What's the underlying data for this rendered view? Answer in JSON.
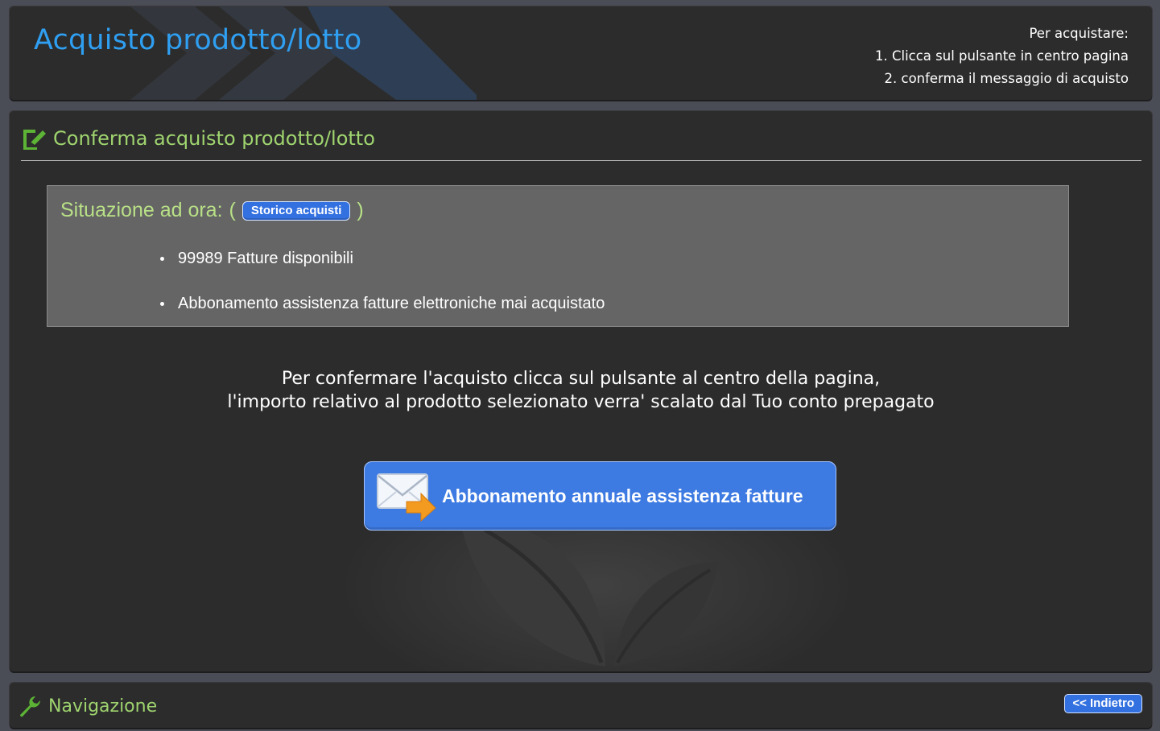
{
  "header": {
    "title": "Acquisto prodotto/lotto",
    "instructions": {
      "intro": "Per acquistare:",
      "step1": "1. Clicca sul pulsante in centro pagina",
      "step2": "2. conferma il messaggio di acquisto"
    }
  },
  "section": {
    "title": "Conferma acquisto prodotto/lotto",
    "icon": "edit-document-icon"
  },
  "status": {
    "label": "Situazione ad ora:",
    "open_paren": "(",
    "close_paren": ")",
    "history_button": "Storico acquisti",
    "items": [
      "99989 Fatture disponibili",
      "Abbonamento assistenza fatture elettroniche mai acquistato"
    ]
  },
  "confirm": {
    "line1": "Per confermare l'acquisto clicca sul pulsante al centro della pagina,",
    "line2": "l'importo relativo al prodotto selezionato verra' scalato dal Tuo conto prepagato"
  },
  "purchase_button": {
    "label": "Abbonamento annuale assistenza fatture",
    "icon": "mail-send-icon"
  },
  "footer": {
    "nav_label": "Navigazione",
    "nav_icon": "wrench-icon",
    "back_button": "<< Indietro"
  },
  "colors": {
    "title_blue": "#2f9ff2",
    "section_green": "#9fd46f",
    "button_blue": "#3d7ae2",
    "panel_bg": "#2c2c2c"
  }
}
